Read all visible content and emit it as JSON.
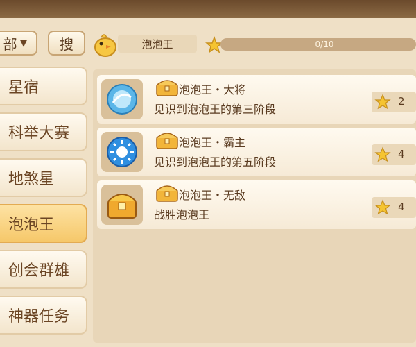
{
  "filter": {
    "select_label": "部",
    "search_label": "搜"
  },
  "target": {
    "name": "泡泡王",
    "progress_text": "0/10",
    "progress_value": 0,
    "progress_max": 10
  },
  "sidebar": {
    "items": [
      {
        "label": "星宿",
        "active": false
      },
      {
        "label": "科举大赛",
        "active": false
      },
      {
        "label": "地煞星",
        "active": false
      },
      {
        "label": "泡泡王",
        "active": true
      },
      {
        "label": "创会群雄",
        "active": false
      },
      {
        "label": "神器任务",
        "active": false
      }
    ]
  },
  "achievements": [
    {
      "icon": "blue-orb-icon",
      "title": "泡泡王・大将",
      "desc": "见识到泡泡王的第三阶段",
      "reward": "2"
    },
    {
      "icon": "blue-sun-orb-icon",
      "title": "泡泡王・霸主",
      "desc": "见识到泡泡王的第五阶段",
      "reward": "4"
    },
    {
      "icon": "gold-chest-icon",
      "title": "泡泡王・无敌",
      "desc": "战胜泡泡王",
      "reward": "4"
    }
  ],
  "colors": {
    "accent": "#f6c86a",
    "progress_track": "#c6a882",
    "text": "#5a3b20"
  }
}
